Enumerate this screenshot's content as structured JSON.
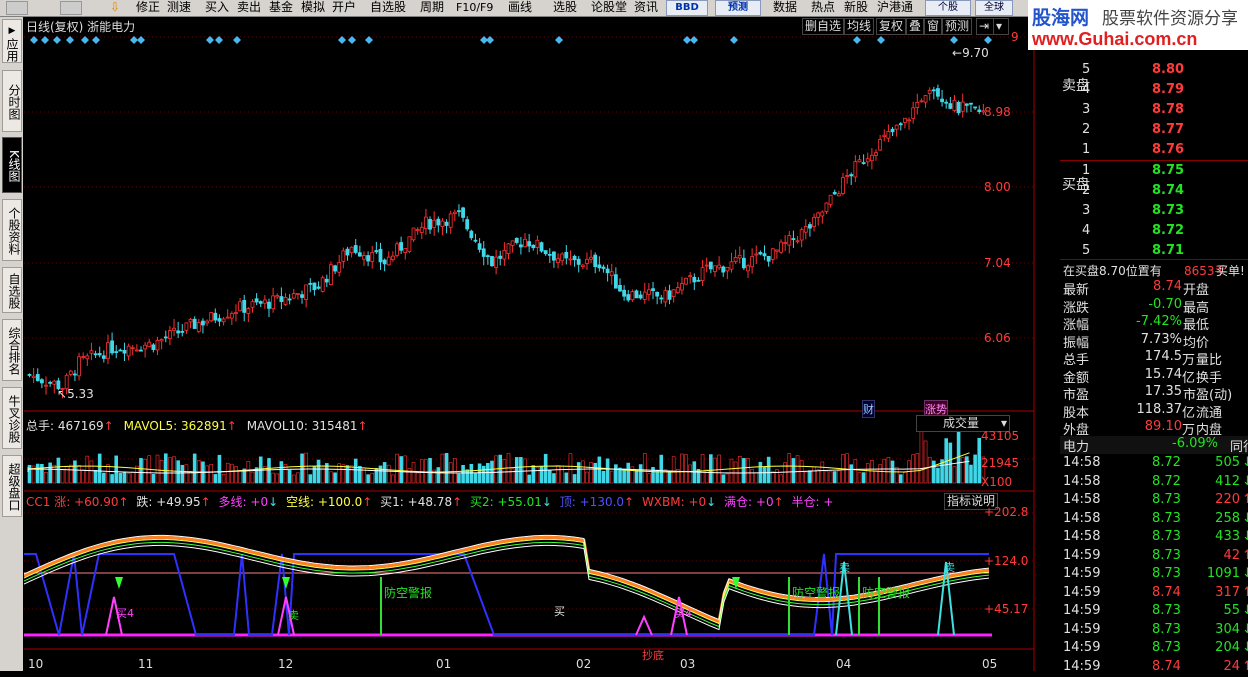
{
  "toolbar": {
    "items": [
      "修正",
      "测速",
      "买入",
      "卖出",
      "基金",
      "模拟",
      "开户",
      "自选股",
      "周期",
      "F10/F9",
      "画线",
      "选股",
      "论股堂",
      "资讯",
      "数据",
      "热点",
      "新股",
      "沪港通"
    ],
    "bbd": "BBD",
    "forecast": "预测",
    "single": "个股",
    "global": "全球"
  },
  "leftnav": {
    "tabs": [
      "应用",
      "分时图",
      "K线图",
      "个股资料",
      "自选股",
      "综合排名",
      "牛叉诊股",
      "超级盘口"
    ],
    "active": 2
  },
  "chart": {
    "title": "日线(复权)  浙能电力",
    "tools": [
      "删自选",
      "均线",
      "复权",
      "叠",
      "窗",
      "预测"
    ],
    "price_axis": [
      "9",
      "8.98",
      "8.00",
      "7.04",
      "6.06"
    ],
    "high_label": "9.70",
    "low_label": "5.33",
    "badges": {
      "cai": "财",
      "zhangshi": "涨势"
    },
    "volume": {
      "total": "总手: 467169",
      "mavol5": "MAVOL5: 362891",
      "mavol10": "MAVOL10: 315481",
      "selector": "成交量",
      "axis": [
        "43105",
        "21945"
      ],
      "unit": "X100"
    },
    "indicator": {
      "cc1": "CC1 涨: +60.90",
      "die": "跌: +49.95",
      "duoxian": "多线: +0",
      "kongxian": "空线: +100.0",
      "buy1": "买1: +48.78",
      "buy2": "买2: +55.01",
      "ding": "顶: +130.0",
      "wxbm": "WXBM: +0",
      "mancang": "满仓: +0",
      "bancang": "半仓: +",
      "help": "指标说明",
      "axis": [
        "+202.8",
        "+124.0",
        "+45.17"
      ],
      "labels": [
        "防空警报",
        "防空警报",
        "防空警报",
        "买4",
        "买4",
        "卖",
        "卖",
        "买",
        "卖",
        "抄底"
      ]
    },
    "months": [
      "10",
      "11",
      "12",
      "01",
      "02",
      "03",
      "04",
      "05"
    ]
  },
  "chart_data": {
    "type": "candlestick",
    "title": "浙能电力 日线(复权)",
    "ylim": [
      5.2,
      9.9
    ],
    "high": 9.7,
    "low": 5.33,
    "months": [
      "10",
      "11",
      "12",
      "01",
      "02",
      "03",
      "04",
      "05"
    ]
  },
  "quote": {
    "ad_cn": "股海网 股票软件资源分享",
    "ad_url": "www.Guhai.com.cn",
    "sell_label": "卖盘",
    "buy_label": "买盘",
    "sell": [
      {
        "lvl": "5",
        "price": "8.80"
      },
      {
        "lvl": "4",
        "price": "8.79"
      },
      {
        "lvl": "3",
        "price": "8.78"
      },
      {
        "lvl": "2",
        "price": "8.77"
      },
      {
        "lvl": "1",
        "price": "8.76"
      }
    ],
    "buy": [
      {
        "lvl": "1",
        "price": "8.75"
      },
      {
        "lvl": "2",
        "price": "8.74"
      },
      {
        "lvl": "3",
        "price": "8.73"
      },
      {
        "lvl": "4",
        "price": "8.72"
      },
      {
        "lvl": "5",
        "price": "8.71"
      }
    ],
    "order_note": "在买盘8.70位置有",
    "order_qty": "8653手",
    "order_type": "买单!",
    "stats": [
      {
        "l": "最新",
        "v": "8.74",
        "u": "",
        "r": "开盘",
        "c": "red"
      },
      {
        "l": "涨跌",
        "v": "-0.70",
        "u": "",
        "r": "最高",
        "c": "green"
      },
      {
        "l": "涨幅",
        "v": "-7.42%",
        "u": "",
        "r": "最低",
        "c": "green"
      },
      {
        "l": "振幅",
        "v": "7.73%",
        "u": "",
        "r": "均价",
        "c": "white"
      },
      {
        "l": "总手",
        "v": "174.5",
        "u": "万",
        "r": "量比",
        "c": "white"
      },
      {
        "l": "金额",
        "v": "15.74",
        "u": "亿",
        "r": "换手",
        "c": "white"
      },
      {
        "l": "市盈",
        "v": "17.35",
        "u": "",
        "r": "市盈(动)",
        "c": "white"
      },
      {
        "l": "股本",
        "v": "118.37",
        "u": "亿",
        "r": "流通",
        "c": "white"
      },
      {
        "l": "外盘",
        "v": "89.10",
        "u": "万",
        "r": "内盘",
        "c": "red"
      }
    ],
    "sector": "电力",
    "sector_pct": "-6.09%",
    "sector_tail": "同行",
    "ticks": [
      {
        "t": "14:58",
        "p": "8.72",
        "q": "505",
        "d": "down"
      },
      {
        "t": "14:58",
        "p": "8.72",
        "q": "412",
        "d": "down"
      },
      {
        "t": "14:58",
        "p": "8.73",
        "q": "220",
        "d": "up"
      },
      {
        "t": "14:58",
        "p": "8.73",
        "q": "258",
        "d": "down"
      },
      {
        "t": "14:58",
        "p": "8.73",
        "q": "433",
        "d": "down"
      },
      {
        "t": "14:59",
        "p": "8.73",
        "q": "42",
        "d": "up"
      },
      {
        "t": "14:59",
        "p": "8.73",
        "q": "1091",
        "d": "down"
      },
      {
        "t": "14:59",
        "p": "8.74",
        "q": "317",
        "d": "up"
      },
      {
        "t": "14:59",
        "p": "8.73",
        "q": "55",
        "d": "down"
      },
      {
        "t": "14:59",
        "p": "8.73",
        "q": "304",
        "d": "down"
      },
      {
        "t": "14:59",
        "p": "8.73",
        "q": "204",
        "d": "down"
      },
      {
        "t": "14:59",
        "p": "8.74",
        "q": "24",
        "d": "up"
      }
    ]
  }
}
